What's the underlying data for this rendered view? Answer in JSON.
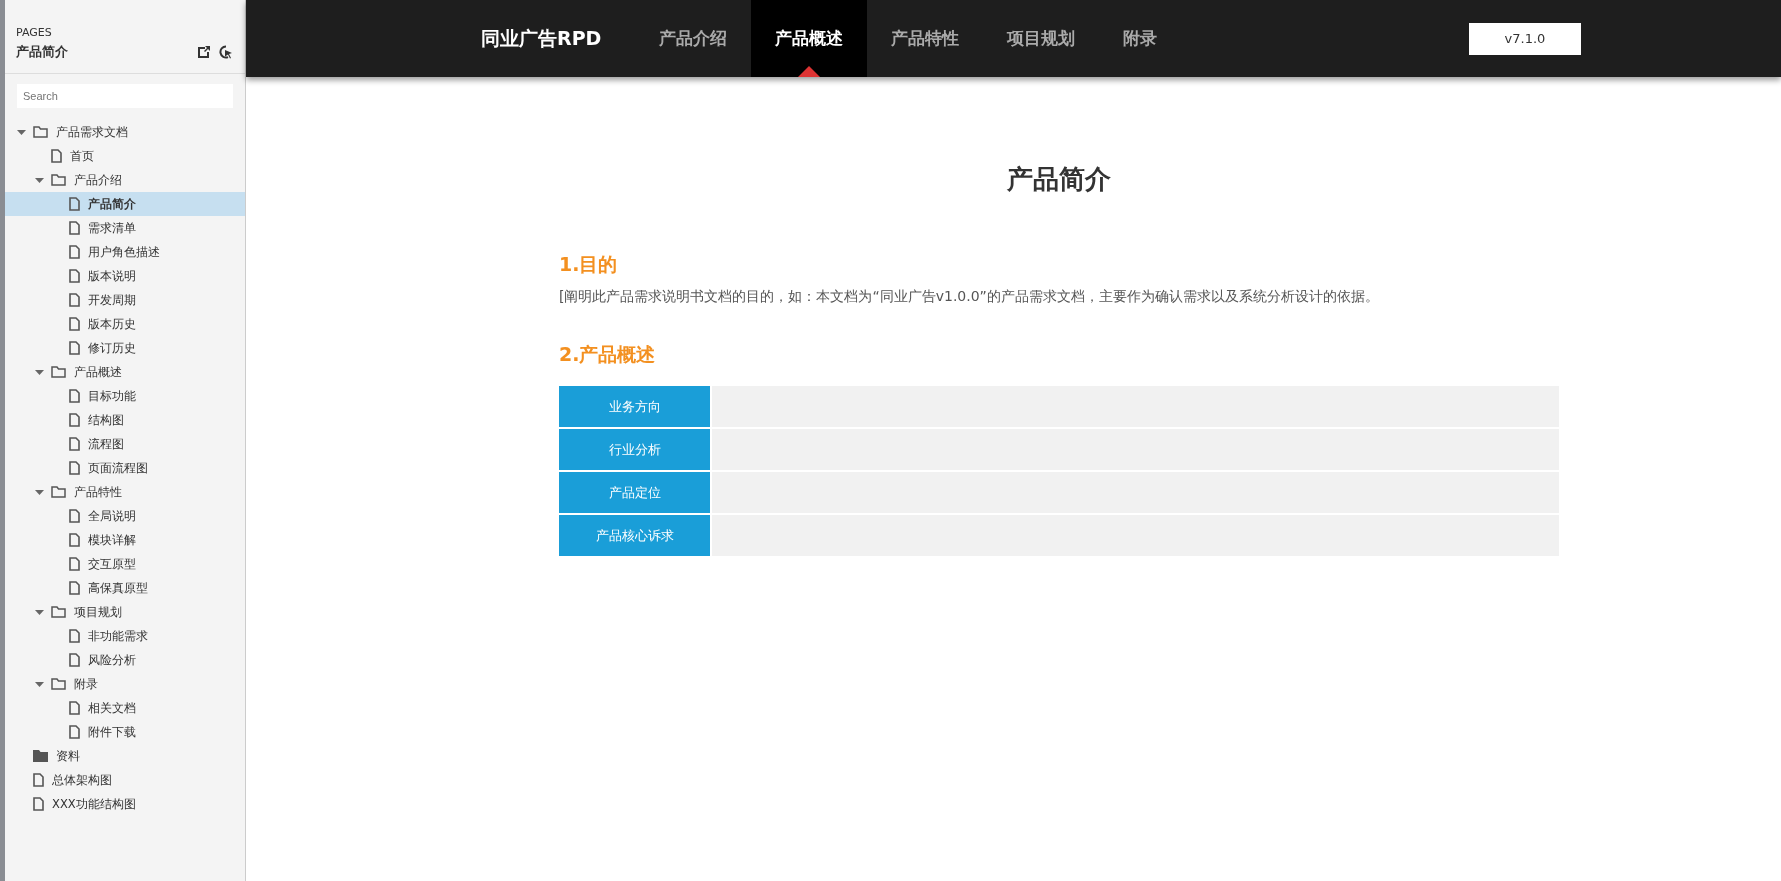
{
  "sidebar": {
    "heading": "PAGES",
    "current_page": "产品简介",
    "search": {
      "placeholder": "Search"
    },
    "tree": [
      {
        "kind": "folder",
        "label": "产品需求文档",
        "expanded": true,
        "selected": false,
        "children": [
          {
            "kind": "page",
            "label": "首页",
            "selected": false
          },
          {
            "kind": "folder",
            "label": "产品介绍",
            "expanded": true,
            "selected": false,
            "children": [
              {
                "kind": "page",
                "label": "产品简介",
                "selected": true
              },
              {
                "kind": "page",
                "label": "需求清单",
                "selected": false
              },
              {
                "kind": "page",
                "label": "用户角色描述",
                "selected": false
              },
              {
                "kind": "page",
                "label": "版本说明",
                "selected": false
              },
              {
                "kind": "page",
                "label": "开发周期",
                "selected": false
              },
              {
                "kind": "page",
                "label": "版本历史",
                "selected": false
              },
              {
                "kind": "page",
                "label": "修订历史",
                "selected": false
              }
            ]
          },
          {
            "kind": "folder",
            "label": "产品概述",
            "expanded": true,
            "selected": false,
            "children": [
              {
                "kind": "page",
                "label": "目标功能",
                "selected": false
              },
              {
                "kind": "page",
                "label": "结构图",
                "selected": false
              },
              {
                "kind": "page",
                "label": "流程图",
                "selected": false
              },
              {
                "kind": "page",
                "label": "页面流程图",
                "selected": false
              }
            ]
          },
          {
            "kind": "folder",
            "label": "产品特性",
            "expanded": true,
            "selected": false,
            "children": [
              {
                "kind": "page",
                "label": "全局说明",
                "selected": false
              },
              {
                "kind": "page",
                "label": "模块详解",
                "selected": false
              },
              {
                "kind": "page",
                "label": "交互原型",
                "selected": false
              },
              {
                "kind": "page",
                "label": "高保真原型",
                "selected": false
              }
            ]
          },
          {
            "kind": "folder",
            "label": "项目规划",
            "expanded": true,
            "selected": false,
            "children": [
              {
                "kind": "page",
                "label": "非功能需求",
                "selected": false
              },
              {
                "kind": "page",
                "label": "风险分析",
                "selected": false
              }
            ]
          },
          {
            "kind": "folder",
            "label": "附录",
            "expanded": true,
            "selected": false,
            "children": [
              {
                "kind": "page",
                "label": "相关文档",
                "selected": false
              },
              {
                "kind": "page",
                "label": "附件下载",
                "selected": false
              }
            ]
          }
        ]
      },
      {
        "kind": "folder",
        "label": "资料",
        "expanded": false,
        "selected": false
      },
      {
        "kind": "page",
        "label": "总体架构图",
        "selected": false
      },
      {
        "kind": "page",
        "label": "XXX功能结构图",
        "selected": false
      }
    ]
  },
  "nav": {
    "brand": "同业广告RPD",
    "tabs": [
      {
        "label": "产品介绍",
        "selected": false
      },
      {
        "label": "产品概述",
        "selected": true
      },
      {
        "label": "产品特性",
        "selected": false
      },
      {
        "label": "项目规划",
        "selected": false
      },
      {
        "label": "附录",
        "selected": false
      }
    ],
    "version": "v7.1.0"
  },
  "content": {
    "title": "产品简介",
    "sections": [
      {
        "heading": "1.目的",
        "text": "[阐明此产品需求说明书文档的目的，如：本文档为“同业广告v1.0.0”的产品需求文档，主要作为确认需求以及系统分析设计的依据。"
      },
      {
        "heading": "2.产品概述"
      }
    ],
    "table": {
      "rows": [
        {
          "label": "业务方向"
        },
        {
          "label": "行业分析"
        },
        {
          "label": "产品定位"
        },
        {
          "label": "产品核心诉求"
        }
      ]
    }
  }
}
